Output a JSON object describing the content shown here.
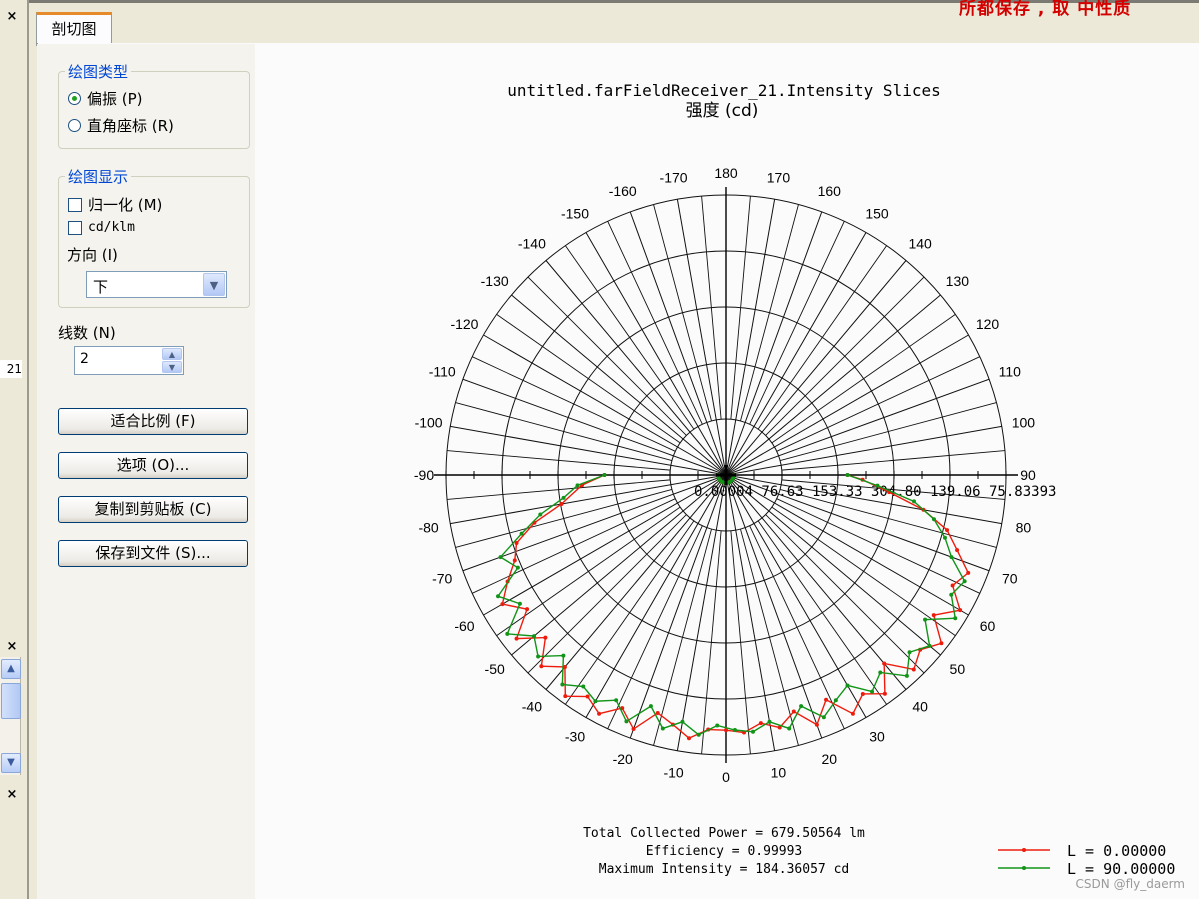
{
  "tab": {
    "label": "剖切图"
  },
  "top_partial_text": "所都保存 , 取 中性质",
  "left_strip": {
    "number": "21",
    "close_glyph": "×"
  },
  "plot_type": {
    "legend": "绘图类型",
    "options": [
      {
        "label": "偏振 (P)",
        "selected": true
      },
      {
        "label": "直角座标 (R)",
        "selected": false
      }
    ]
  },
  "display": {
    "legend": "绘图显示",
    "normalize": {
      "label": "归一化 (M)",
      "checked": false
    },
    "cdklm": {
      "label": "cd/klm",
      "checked": false
    },
    "direction_label": "方向 (I)",
    "direction_value": "下"
  },
  "lines": {
    "label": "线数 (N)",
    "value": "2"
  },
  "buttons": {
    "fit": "适合比例 (F)",
    "options": "选项 (O)...",
    "copy": "复制到剪贴板 (C)",
    "save": "保存到文件 (S)..."
  },
  "chart_data": {
    "type": "polar",
    "title": "untitled.farFieldReceiver_21.Intensity Slices",
    "subtitle": "强度 (cd)",
    "angle_ticks": [
      180,
      170,
      160,
      150,
      140,
      130,
      120,
      110,
      100,
      90,
      80,
      70,
      60,
      50,
      40,
      30,
      20,
      10,
      0,
      -10,
      -20,
      -30,
      -40,
      -50,
      -60,
      -70,
      -80,
      -90,
      -100,
      -110,
      -120,
      -130,
      -140,
      -150,
      -160,
      -170
    ],
    "radial_tick_text": "0.00004  76.63  153.33  304.80  139.06  75.83393",
    "rmax": 184.36057,
    "rings": 5,
    "spokes_per_side": 17,
    "series": [
      {
        "name": "L = 0.00000",
        "color": "#ee1c0c",
        "points": [
          [
            -90,
            80
          ],
          [
            -86,
            95
          ],
          [
            -80,
            110
          ],
          [
            -76,
            130
          ],
          [
            -72,
            145
          ],
          [
            -68,
            150
          ],
          [
            -64,
            160
          ],
          [
            -60,
            170
          ],
          [
            -56,
            158
          ],
          [
            -52,
            175
          ],
          [
            -48,
            160
          ],
          [
            -44,
            175
          ],
          [
            -40,
            165
          ],
          [
            -36,
            180
          ],
          [
            -32,
            172
          ],
          [
            -28,
            178
          ],
          [
            -24,
            168
          ],
          [
            -20,
            178
          ],
          [
            -16,
            163
          ],
          [
            -12,
            168
          ],
          [
            -8,
            175
          ],
          [
            -4,
            168
          ],
          [
            0,
            168
          ],
          [
            4,
            170
          ],
          [
            8,
            165
          ],
          [
            12,
            170
          ],
          [
            16,
            162
          ],
          [
            20,
            175
          ],
          [
            24,
            162
          ],
          [
            28,
            178
          ],
          [
            32,
            170
          ],
          [
            36,
            178
          ],
          [
            40,
            162
          ],
          [
            44,
            178
          ],
          [
            48,
            172
          ],
          [
            52,
            180
          ],
          [
            56,
            165
          ],
          [
            60,
            178
          ],
          [
            64,
            166
          ],
          [
            68,
            172
          ],
          [
            72,
            160
          ],
          [
            76,
            150
          ],
          [
            80,
            132
          ],
          [
            84,
            108
          ],
          [
            88,
            90
          ],
          [
            90,
            80
          ]
        ]
      },
      {
        "name": "L = 90.00000",
        "color": "#119418",
        "points": [
          [
            -90,
            80
          ],
          [
            -86,
            98
          ],
          [
            -82,
            108
          ],
          [
            -78,
            125
          ],
          [
            -74,
            140
          ],
          [
            -70,
            158
          ],
          [
            -66,
            150
          ],
          [
            -62,
            170
          ],
          [
            -58,
            160
          ],
          [
            -54,
            178
          ],
          [
            -50,
            165
          ],
          [
            -46,
            172
          ],
          [
            -42,
            160
          ],
          [
            -38,
            175
          ],
          [
            -34,
            168
          ],
          [
            -30,
            172
          ],
          [
            -26,
            165
          ],
          [
            -22,
            175
          ],
          [
            -18,
            160
          ],
          [
            -14,
            172
          ],
          [
            -10,
            165
          ],
          [
            -6,
            172
          ],
          [
            -2,
            165
          ],
          [
            2,
            168
          ],
          [
            6,
            170
          ],
          [
            10,
            165
          ],
          [
            14,
            172
          ],
          [
            18,
            160
          ],
          [
            22,
            172
          ],
          [
            26,
            165
          ],
          [
            30,
            160
          ],
          [
            34,
            172
          ],
          [
            38,
            165
          ],
          [
            42,
            178
          ],
          [
            46,
            168
          ],
          [
            50,
            175
          ],
          [
            54,
            162
          ],
          [
            58,
            178
          ],
          [
            62,
            168
          ],
          [
            66,
            172
          ],
          [
            70,
            158
          ],
          [
            74,
            150
          ],
          [
            78,
            140
          ],
          [
            82,
            125
          ],
          [
            86,
            100
          ],
          [
            90,
            80
          ]
        ]
      }
    ],
    "stats": [
      "Total Collected Power = 679.50564  lm",
      "Efficiency = 0.99993",
      "Maximum Intensity = 184.36057  cd"
    ]
  },
  "watermark": "CSDN @fly_daerm"
}
